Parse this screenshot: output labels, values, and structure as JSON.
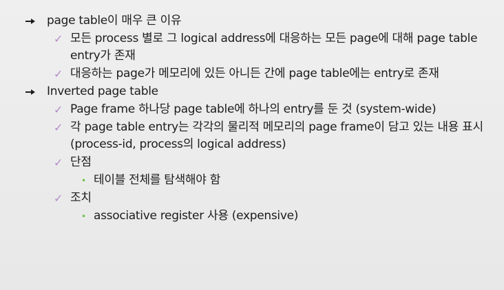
{
  "items": [
    {
      "level": 1,
      "text": "page table이 매우 큰 이유",
      "children": [
        {
          "text": "모든 process 별로 그 logical address에 대응하는 모든 page에 대해 page table entry가 존재"
        },
        {
          "text": "대응하는 page가 메모리에 있든 아니든 간에 page table에는 entry로 존재"
        }
      ]
    },
    {
      "level": 1,
      "text": "Inverted page table",
      "children": [
        {
          "text": "Page frame 하나당 page table에 하나의 entry를 둔 것 (system-wide)"
        },
        {
          "text": "각 page table entry는 각각의 물리적 메모리의 page frame이 담고 있는 내용 표시 (process-id, process의 logical address)"
        },
        {
          "text": "단점",
          "sub": [
            "테이블 전체를 탐색해야 함"
          ]
        },
        {
          "text": "조치",
          "sub": [
            "associative register 사용 (expensive)"
          ]
        }
      ]
    }
  ],
  "icons": {
    "level1": "arrow-bullet-icon",
    "level2": "checkmark-bullet-icon",
    "level3": "dot-bullet-icon"
  },
  "colors": {
    "background": "#ebebeb",
    "text": "#1c1c1c",
    "checkmark": "#b48ac8",
    "dot": "#6cc04a"
  },
  "glyphs": {
    "check": "✓",
    "dot": "•"
  }
}
